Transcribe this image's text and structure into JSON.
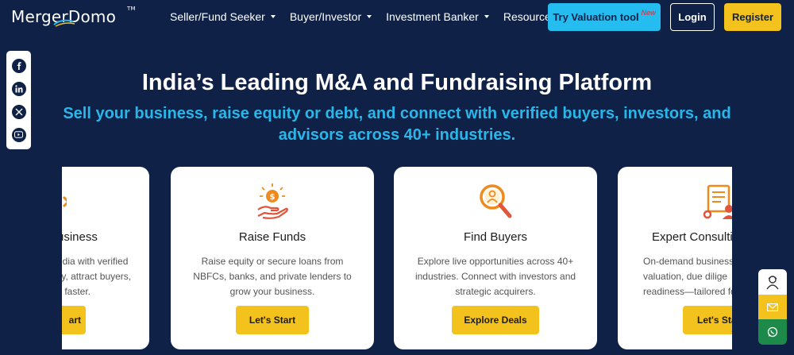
{
  "header": {
    "logo_text": "MergerDomo",
    "logo_tm": "TM",
    "nav": [
      {
        "label": "Seller/Fund Seeker",
        "dropdown": true
      },
      {
        "label": "Buyer/Investor",
        "dropdown": true
      },
      {
        "label": "Investment Banker",
        "dropdown": true
      },
      {
        "label": "Resources",
        "dropdown": false
      }
    ],
    "valuation_label": "Try Valuation tool",
    "valuation_badge": "New",
    "login_label": "Login",
    "register_label": "Register"
  },
  "social": [
    "facebook-icon",
    "linkedin-icon",
    "x-icon",
    "youtube-icon"
  ],
  "hero": {
    "title": "India’s Leading M&A and Fundraising Platform",
    "subtitle": "Sell your business, raise equity or debt, and connect with verified buyers, investors, and advisors across 40+ industries."
  },
  "cards": [
    {
      "title": "usiness",
      "desc": "ndia with verified\nlly, attract buyers,\ns faster.",
      "button": "art"
    },
    {
      "title": "Raise Funds",
      "desc": "Raise equity or secure loans from NBFCs, banks, and private lenders to grow your business.",
      "button": "Let's Start"
    },
    {
      "title": "Find Buyers",
      "desc": "Explore live opportunities across 40+ industries. Connect with investors and strategic acquirers.",
      "button": "Explore Deals"
    },
    {
      "title": "Expert Consulti",
      "desc": "On-demand business\nvaluation, due dilige\nreadiness—tailored fo",
      "button": "Let's Sta"
    }
  ],
  "colors": {
    "background": "#0f2147",
    "accent_blue": "#29b7ea",
    "accent_yellow": "#f3c21c",
    "icon_orange": "#f08a1c"
  }
}
